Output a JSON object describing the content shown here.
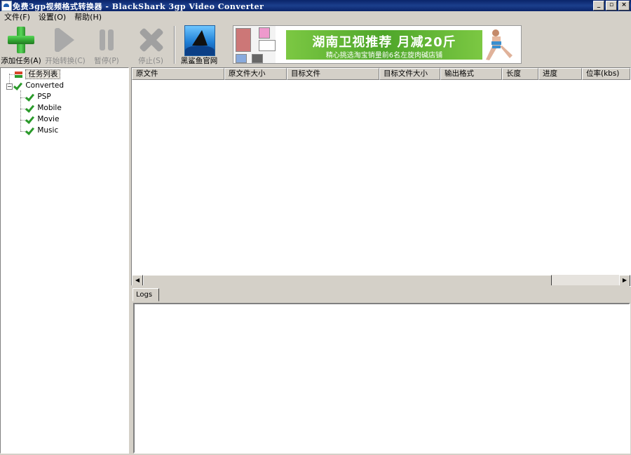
{
  "window": {
    "title": "免费3gp视频格式转换器 - BlackShark 3gp Video Converter",
    "buttons": {
      "minimize": "_",
      "restore": "▫",
      "close": "×"
    }
  },
  "menu": [
    "文件(F)",
    "设置(O)",
    "帮助(H)"
  ],
  "toolbar": {
    "add": "添加任务(A)",
    "start": "开始转换(C)",
    "pause": "暂停(P)",
    "stop": "停止(S)",
    "website": "黑鲨鱼官网"
  },
  "banner": {
    "title": "湖南卫视推荐 月减20斤",
    "subtitle": "精心挑选淘宝销量前6名左旋肉碱店铺"
  },
  "tree": {
    "root": "任务列表",
    "group": "Converted",
    "children": [
      "PSP",
      "Mobile",
      "Movie",
      "Music"
    ]
  },
  "table": {
    "columns": [
      "原文件",
      "原文件大小",
      "目标文件",
      "目标文件大小",
      "输出格式",
      "长度",
      "进度",
      "位率(kbs)"
    ]
  },
  "logs": {
    "tab": "Logs"
  },
  "colors": {
    "title_bar": "#0a246a",
    "face": "#d4d0c8",
    "banner_green": "#4ea62a"
  },
  "icons": {
    "add": "plus-icon",
    "start": "play-icon",
    "pause": "pause-icon",
    "stop": "stop-icon",
    "website": "shark-icon"
  }
}
